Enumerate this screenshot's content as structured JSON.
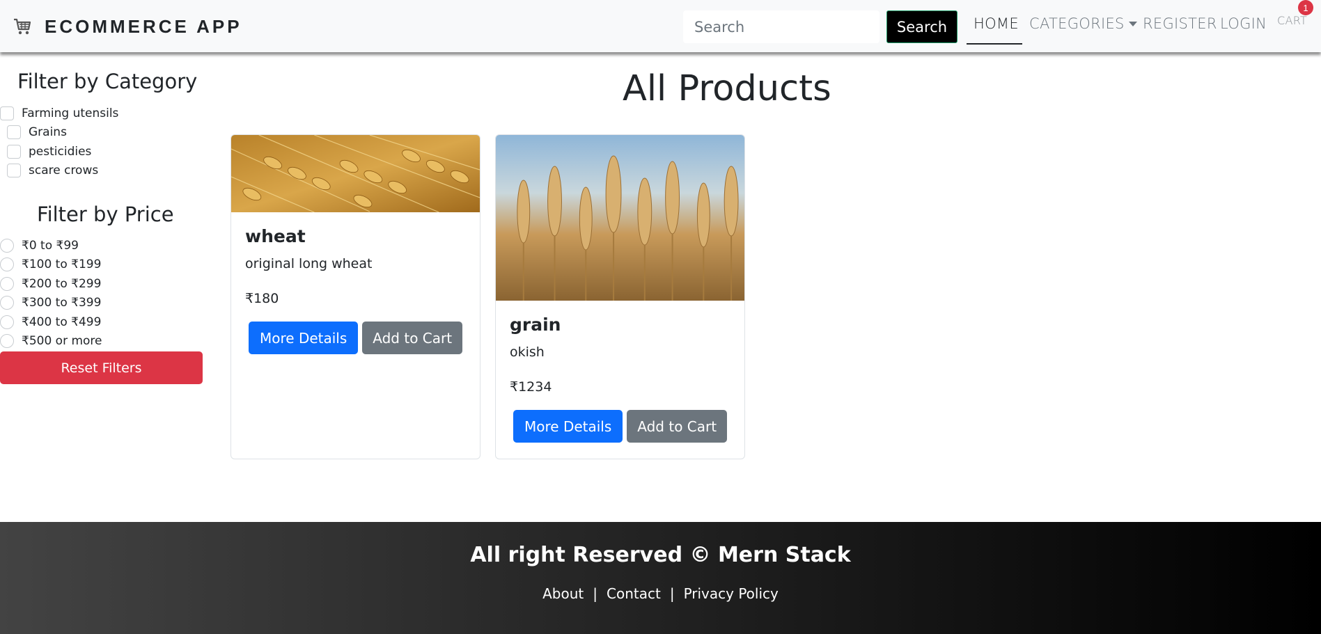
{
  "navbar": {
    "brand_icon": "shopping-cart-icon",
    "brand": "ECOMMERCE APP",
    "search_placeholder": "Search",
    "search_button": "Search",
    "links": {
      "home": "HOME",
      "categories": "CATEGORIES",
      "register": "REGISTER",
      "login": "LOGIN",
      "cart": "CART"
    },
    "cart_count": "1"
  },
  "sidebar": {
    "category_title": "Filter by Category",
    "categories": [
      "Farming utensils",
      "Grains",
      "pesticidies",
      "scare crows"
    ],
    "price_title": "Filter by Price",
    "prices": [
      "₹0 to ₹99",
      "₹100 to ₹199",
      "₹200 to ₹299",
      "₹300 to ₹399",
      "₹400 to ₹499",
      "₹500 or more"
    ],
    "reset_button": "Reset Filters"
  },
  "main": {
    "title": "All Products",
    "products": [
      {
        "name": "wheat",
        "description": "original long wheat",
        "price": "₹180",
        "details_button": "More Details",
        "cart_button": "Add to Cart"
      },
      {
        "name": "grain",
        "description": "okish",
        "price": "₹1234",
        "details_button": "More Details",
        "cart_button": "Add to Cart"
      }
    ]
  },
  "footer": {
    "title": "All right Reserved © Mern Stack",
    "links": [
      "About",
      "Contact",
      "Privacy Policy"
    ],
    "separator": "|"
  },
  "colors": {
    "primary": "#0d6efd",
    "secondary": "#6c757d",
    "danger": "#dc3545",
    "navbar_bg": "#f8f9fa"
  }
}
